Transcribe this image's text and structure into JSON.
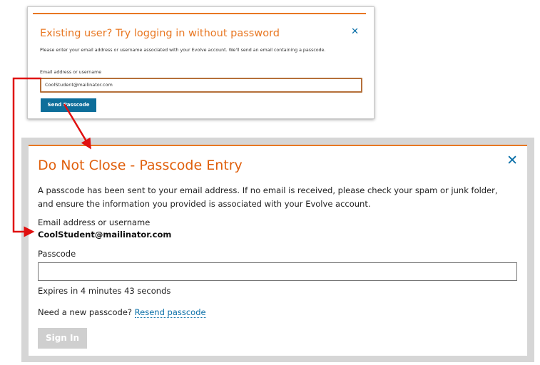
{
  "small_modal": {
    "title": "Existing user? Try logging in without password",
    "close_glyph": "✕",
    "description": "Please enter your email address or username associated with your Evolve account. We'll send an email containing a passcode.",
    "field_label": "Email address or username",
    "field_value": "CoolStudent@mailinator.com",
    "button_label": "Send Passcode"
  },
  "big_modal": {
    "title": "Do Not Close - Passcode Entry",
    "close_glyph": "✕",
    "description": "A passcode has been sent to your email address. If no email is received, please check your spam or junk folder, and ensure the information you provided is associated with your Evolve account.",
    "email_label": "Email address or username",
    "email_value": "CoolStudent@mailinator.com",
    "passcode_label": "Passcode",
    "passcode_value": "",
    "expires_text": "Expires in 4 minutes 43 seconds",
    "need_text": "Need a new passcode?",
    "resend_link": "Resend passcode",
    "signin_label": "Sign In"
  },
  "colors": {
    "accent_orange": "#e87722",
    "link_blue": "#0a6fa8",
    "button_blue": "#0d6e9a",
    "arrow_red": "#e01010",
    "disabled_gray": "#cfcfcf"
  }
}
